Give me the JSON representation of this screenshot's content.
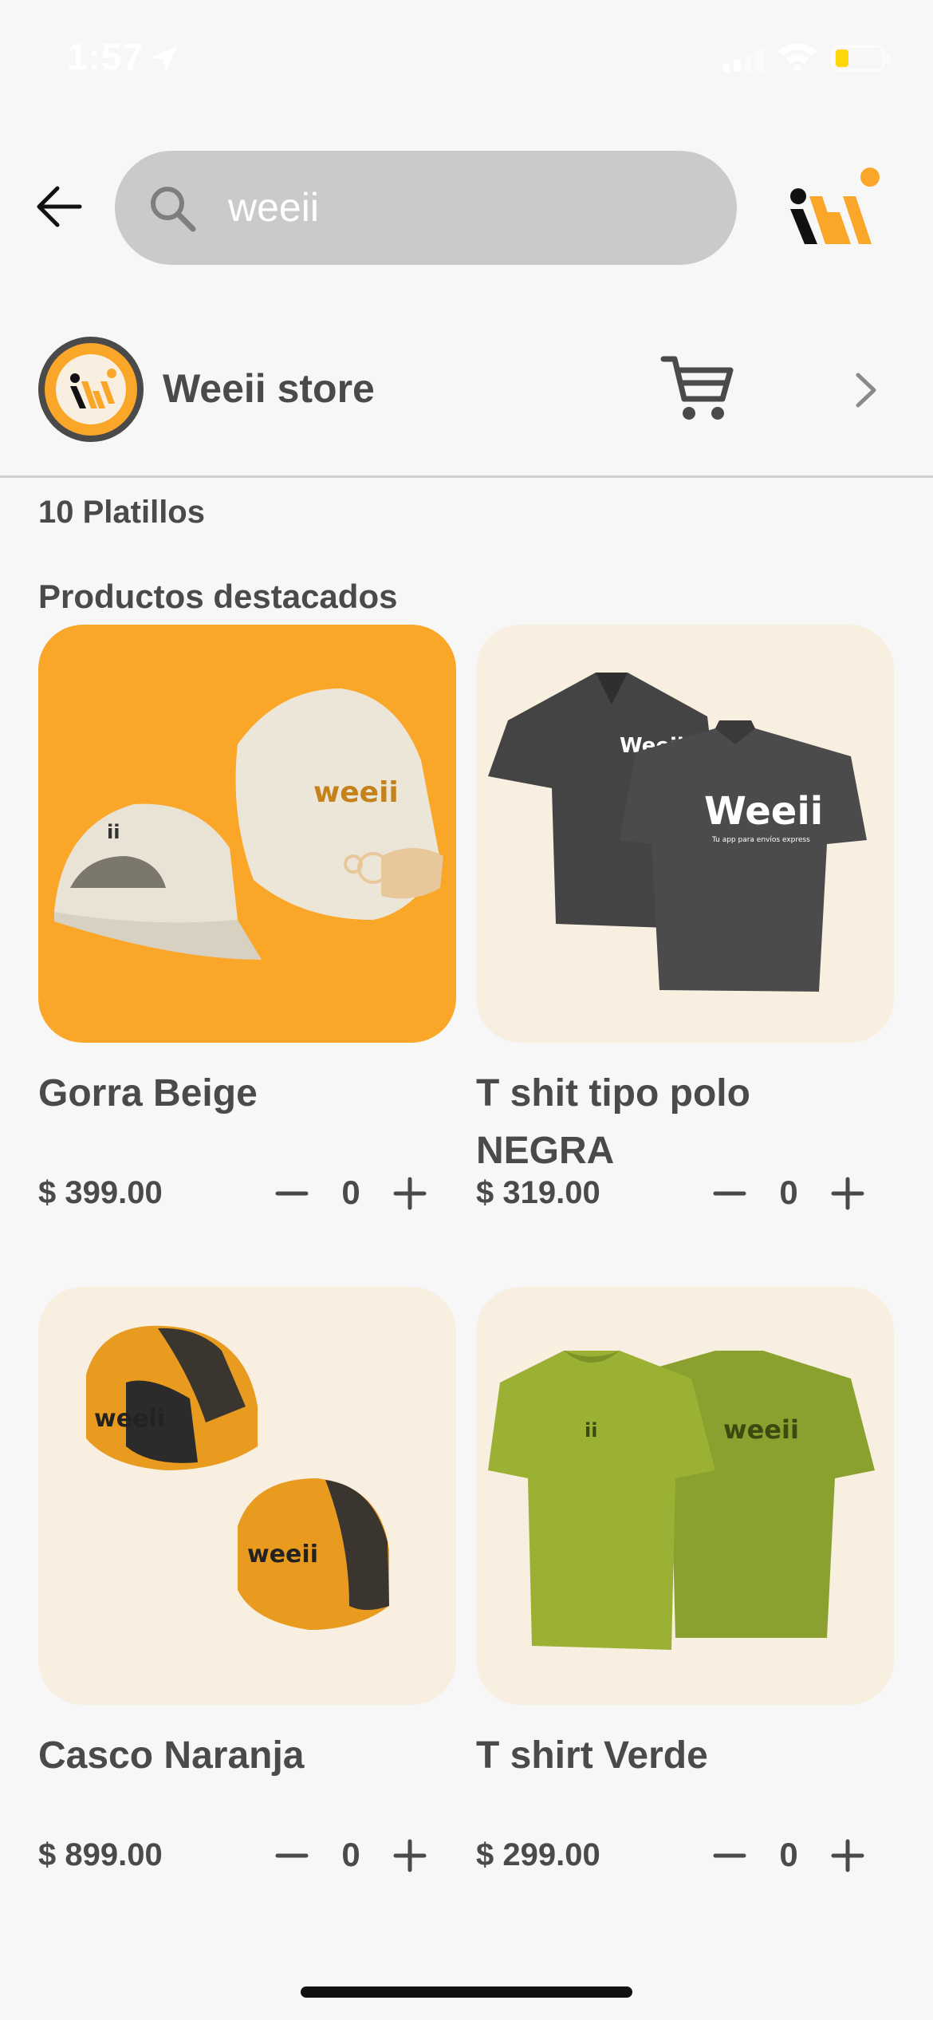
{
  "status_bar": {
    "time": "1:57"
  },
  "header": {
    "search": {
      "value": "weeii",
      "placeholder": ""
    },
    "back_icon": "arrow-left-icon",
    "logo_icon": "weeii-logo"
  },
  "store": {
    "name": "Weeii store",
    "cart_icon": "cart-icon",
    "chevron_icon": "chevron-right-icon"
  },
  "count_label": "10 Platillos",
  "section_title": "Productos destacados",
  "colors": {
    "accent": "#faa629",
    "card_cream": "#f8efe0",
    "text": "#4a4a4a",
    "search_bg": "#cacaca"
  },
  "products": [
    {
      "name": "Gorra Beige",
      "price": "$ 399.00",
      "qty": "0",
      "image": "beige-cap"
    },
    {
      "name": "T shit tipo polo NEGRA",
      "price": "$ 319.00",
      "qty": "0",
      "image": "black-polo"
    },
    {
      "name": "Casco Naranja",
      "price": "$ 899.00",
      "qty": "0",
      "image": "orange-helmet"
    },
    {
      "name": "T shirt Verde",
      "price": "$ 299.00",
      "qty": "0",
      "image": "green-tshirt"
    }
  ],
  "brand_text": {
    "cap": "weeii",
    "polo_small": "Weeii",
    "polo_big": "Weeii",
    "polo_tagline": "Tu app para envíos express",
    "helmet_a": "weeii",
    "helmet_b": "weeii",
    "tshirt": "weeii"
  }
}
